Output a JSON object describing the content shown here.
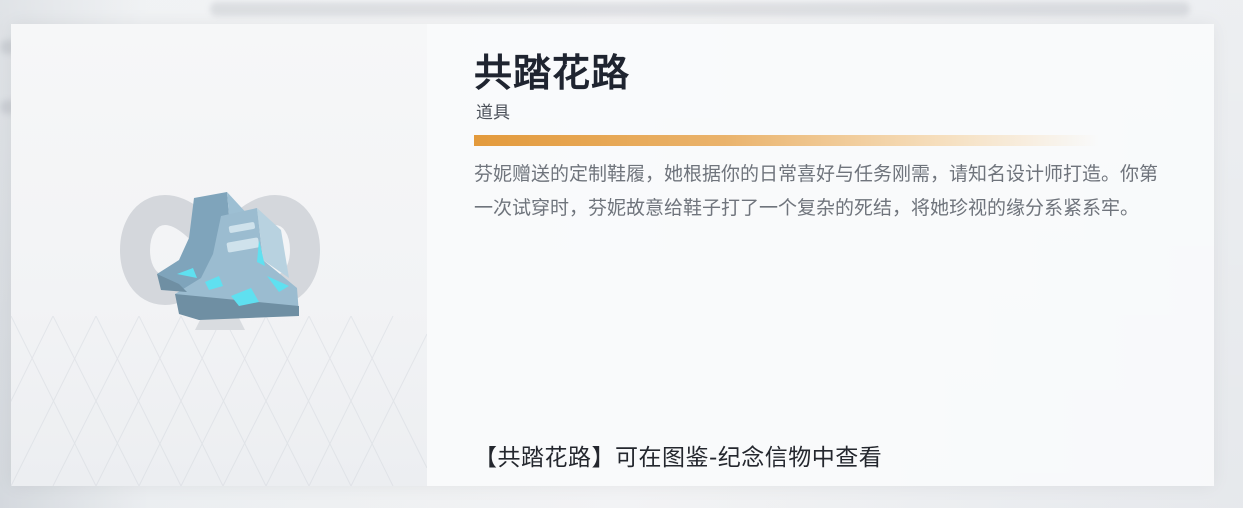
{
  "item": {
    "name": "共踏花路",
    "category": "道具",
    "description": "芬妮赠送的定制鞋履，她根据你的日常喜好与任务刚需，请知名设计师打造。你第一次试穿时，芬妮故意给鞋子打了一个复杂的死结，将她珍视的缘分系紧系牢。",
    "collection_note": "【共踏花路】可在图鉴-纪念信物中查看",
    "image_icon": "sneakers-icon",
    "emblem_icon": "knot-emblem-icon"
  },
  "colors": {
    "accent": "#e39a3c",
    "shoe": "#8fb3c9",
    "glow": "#5fe0f0"
  }
}
